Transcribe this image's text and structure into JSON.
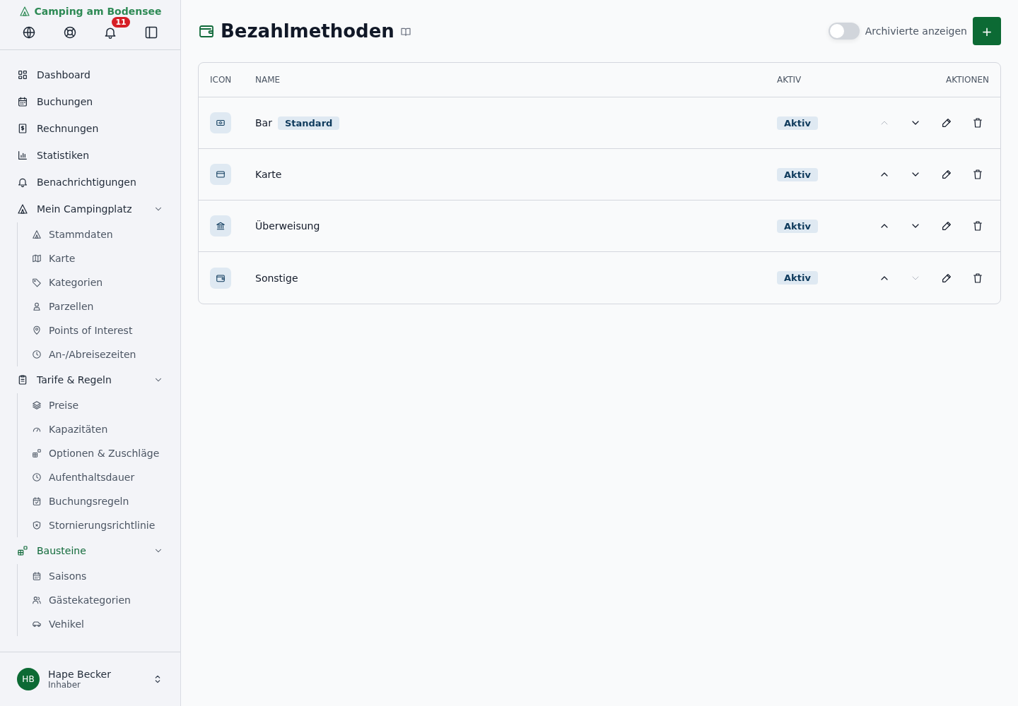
{
  "sidebar": {
    "brand": "Camping am Bodensee",
    "notification_count": "11",
    "nav": [
      {
        "label": "Dashboard",
        "selected": false
      },
      {
        "label": "Buchungen",
        "selected": false
      },
      {
        "label": "Rechnungen",
        "selected": false
      },
      {
        "label": "Statistiken",
        "selected": false
      },
      {
        "label": "Benachrichtigungen",
        "selected": false
      },
      {
        "label": "Mein Campingplatz",
        "selected": false,
        "expanded": true,
        "children": [
          {
            "label": "Stammdaten",
            "selected": false
          },
          {
            "label": "Karte",
            "selected": false
          },
          {
            "label": "Kategorien",
            "selected": false
          },
          {
            "label": "Parzellen",
            "selected": false
          },
          {
            "label": "Points of Interest",
            "selected": false
          },
          {
            "label": "An-/Abreisezeiten",
            "selected": false
          }
        ]
      },
      {
        "label": "Tarife & Regeln",
        "selected": false,
        "expanded": true,
        "children": [
          {
            "label": "Preise",
            "selected": false
          },
          {
            "label": "Kapazitäten",
            "selected": false
          },
          {
            "label": "Optionen & Zuschläge",
            "selected": false
          },
          {
            "label": "Aufenthaltsdauer",
            "selected": false
          },
          {
            "label": "Buchungsregeln",
            "selected": false
          },
          {
            "label": "Stornierungsrichtlinie",
            "selected": false
          }
        ]
      },
      {
        "label": "Bausteine",
        "selected": true,
        "expanded": true,
        "children": [
          {
            "label": "Saisons",
            "selected": false
          },
          {
            "label": "Gästekategorien",
            "selected": false
          },
          {
            "label": "Vehikel",
            "selected": false
          }
        ]
      }
    ],
    "user": {
      "initials": "HB",
      "name": "Hape Becker",
      "role": "Inhaber"
    }
  },
  "page": {
    "title": "Bezahlmethoden",
    "archived_toggle": {
      "label": "Archivierte anzeigen",
      "on": false
    },
    "add_button": "+"
  },
  "table": {
    "columns": [
      "ICON",
      "NAME",
      "AKTIV",
      "AKTIONEN"
    ],
    "rows": [
      {
        "name": "Bar",
        "badge": "Standard",
        "status": "Aktiv",
        "up_disabled": true,
        "down_disabled": false
      },
      {
        "name": "Karte",
        "status": "Aktiv",
        "up_disabled": false,
        "down_disabled": false
      },
      {
        "name": "Überweisung",
        "status": "Aktiv",
        "up_disabled": false,
        "down_disabled": false
      },
      {
        "name": "Sonstige",
        "status": "Aktiv",
        "up_disabled": false,
        "down_disabled": true
      }
    ]
  }
}
